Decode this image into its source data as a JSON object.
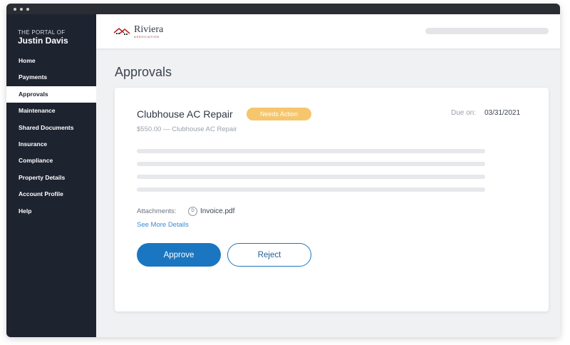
{
  "sidebar": {
    "portal_label": "THE PORTAL OF",
    "user_name": "Justin Davis",
    "items": [
      {
        "label": "Home"
      },
      {
        "label": "Payments"
      },
      {
        "label": "Approvals",
        "active": true
      },
      {
        "label": "Maintenance"
      },
      {
        "label": "Shared Documents"
      },
      {
        "label": "Insurance"
      },
      {
        "label": "Compliance"
      },
      {
        "label": "Property Details"
      },
      {
        "label": "Account Profile"
      },
      {
        "label": "Help"
      }
    ]
  },
  "header": {
    "logo_name": "Riviera",
    "logo_sub": "ASSOCIATION"
  },
  "main": {
    "page_title": "Approvals",
    "card": {
      "title": "Clubhouse AC Repair",
      "badge": "Needs Action",
      "due_label": "Due on:",
      "due_value": "03/31/2021",
      "subtitle": "$550.00 — Clubhouse AC Repair",
      "attachments_label": "Attachments:",
      "attachment_icon_glyph": "D",
      "attachment_file": "Invoice.pdf",
      "see_more": "See More Details",
      "approve_label": "Approve",
      "reject_label": "Reject"
    }
  },
  "colors": {
    "sidebar_bg": "#1e2330",
    "accent": "#1a76c1",
    "badge": "#f5c66c",
    "link": "#3d8ad0",
    "logo_roof": "#b3262b"
  },
  "icons": {
    "logo": "house-roof-icon",
    "attachment": "document-icon"
  }
}
